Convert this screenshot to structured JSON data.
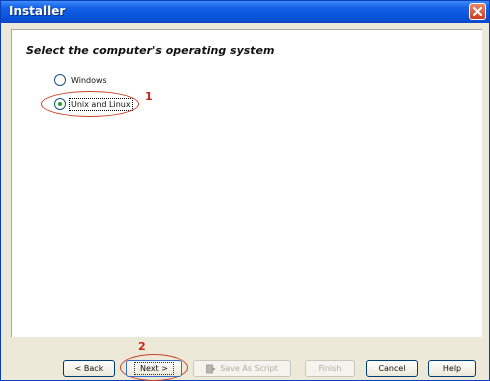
{
  "window": {
    "title": "Installer"
  },
  "heading": "Select the computer's operating system",
  "options": [
    {
      "label": "Windows",
      "selected": false
    },
    {
      "label": "Unix and Linux",
      "selected": true
    }
  ],
  "annotations": {
    "step1": "1",
    "step2": "2"
  },
  "buttons": {
    "back": "< Back",
    "next": "Next >",
    "save_script": "Save As Script",
    "finish": "Finish",
    "cancel": "Cancel",
    "help": "Help"
  },
  "colors": {
    "titlebar": "#0a55dd",
    "annotation": "#c8442b",
    "radio_selected": "#21a121"
  }
}
